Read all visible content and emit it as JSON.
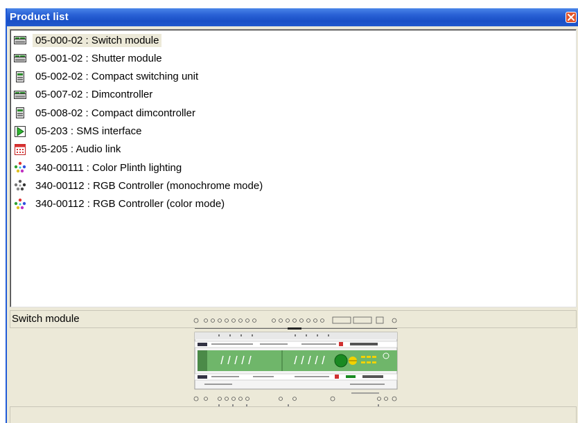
{
  "window": {
    "title": "Product list"
  },
  "products": [
    {
      "label": "05-000-02 : Switch module",
      "icon": "switch-module-icon",
      "selected": true
    },
    {
      "label": "05-001-02 : Shutter module",
      "icon": "shutter-module-icon",
      "selected": false
    },
    {
      "label": "05-002-02 : Compact switching unit",
      "icon": "compact-unit-icon",
      "selected": false
    },
    {
      "label": "05-007-02 : Dimcontroller",
      "icon": "dimcontroller-icon",
      "selected": false
    },
    {
      "label": "05-008-02 : Compact dimcontroller",
      "icon": "compact-dimcontroller-icon",
      "selected": false
    },
    {
      "label": "05-203 : SMS interface",
      "icon": "sms-interface-icon",
      "selected": false
    },
    {
      "label": "05-205 : Audio link",
      "icon": "audio-link-icon",
      "selected": false
    },
    {
      "label": "340-00111 : Color Plinth lighting",
      "icon": "color-dots-icon",
      "selected": false
    },
    {
      "label": "340-00112 : RGB Controller (monochrome mode)",
      "icon": "mono-dots-icon",
      "selected": false
    },
    {
      "label": "340-00112 : RGB Controller (color mode)",
      "icon": "color-dots-icon",
      "selected": false
    }
  ],
  "status": {
    "text": "Switch module"
  },
  "colors": {
    "titlebar": "#2a62d6",
    "selection": "#ece9d8",
    "close_button": "#e0542c"
  }
}
